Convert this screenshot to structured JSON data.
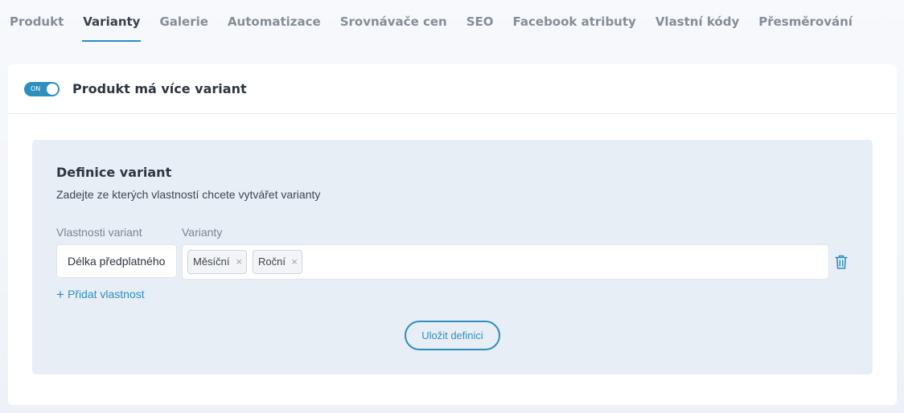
{
  "tabs": [
    {
      "label": "Produkt",
      "active": false
    },
    {
      "label": "Varianty",
      "active": true
    },
    {
      "label": "Galerie",
      "active": false
    },
    {
      "label": "Automatizace",
      "active": false
    },
    {
      "label": "Srovnávače cen",
      "active": false
    },
    {
      "label": "SEO",
      "active": false
    },
    {
      "label": "Facebook atributy",
      "active": false
    },
    {
      "label": "Vlastní kódy",
      "active": false
    },
    {
      "label": "Přesměrování",
      "active": false
    }
  ],
  "header": {
    "toggle_label": "ON",
    "toggle_on": true,
    "title": "Produkt má více variant"
  },
  "definition": {
    "title": "Definice variant",
    "description": "Zadejte ze kterých vlastností chcete vytvářet varianty",
    "properties_label": "Vlastnosti variant",
    "variants_label": "Varianty",
    "property_value": "Délka předplatného",
    "variant_tags": [
      "Měsíční",
      "Roční"
    ],
    "tag_remove_symbol": "×",
    "add_property_label": "Přidat vlastnost",
    "add_property_icon": "+",
    "save_label": "Uložit definici"
  },
  "colors": {
    "accent": "#2d8fbe",
    "panel_bg": "#e8eef6",
    "page_bg": "#f1f5fa"
  },
  "icons": {
    "toggle": "toggle-switch-icon",
    "tag_remove": "close-icon",
    "delete": "trash-icon",
    "add": "plus-icon"
  }
}
